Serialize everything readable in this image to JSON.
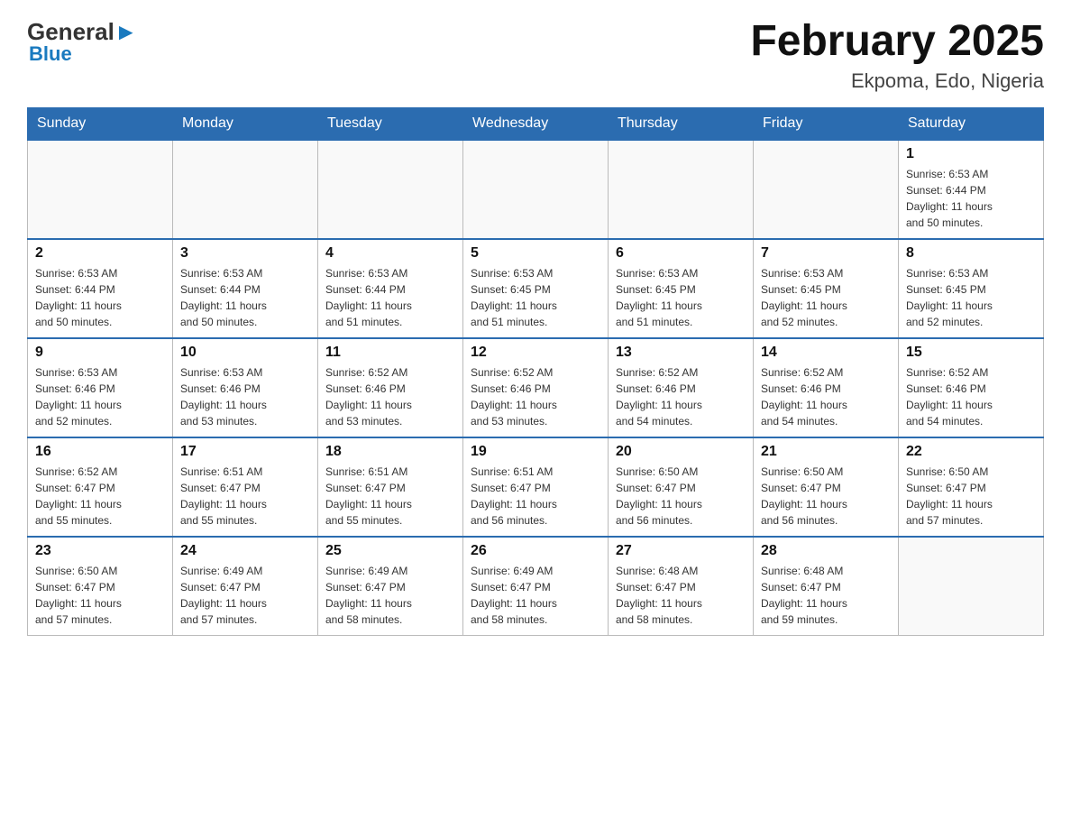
{
  "header": {
    "logo_general": "General",
    "logo_blue": "Blue",
    "month_title": "February 2025",
    "location": "Ekpoma, Edo, Nigeria"
  },
  "weekdays": [
    "Sunday",
    "Monday",
    "Tuesday",
    "Wednesday",
    "Thursday",
    "Friday",
    "Saturday"
  ],
  "weeks": [
    [
      {
        "day": "",
        "info": ""
      },
      {
        "day": "",
        "info": ""
      },
      {
        "day": "",
        "info": ""
      },
      {
        "day": "",
        "info": ""
      },
      {
        "day": "",
        "info": ""
      },
      {
        "day": "",
        "info": ""
      },
      {
        "day": "1",
        "info": "Sunrise: 6:53 AM\nSunset: 6:44 PM\nDaylight: 11 hours\nand 50 minutes."
      }
    ],
    [
      {
        "day": "2",
        "info": "Sunrise: 6:53 AM\nSunset: 6:44 PM\nDaylight: 11 hours\nand 50 minutes."
      },
      {
        "day": "3",
        "info": "Sunrise: 6:53 AM\nSunset: 6:44 PM\nDaylight: 11 hours\nand 50 minutes."
      },
      {
        "day": "4",
        "info": "Sunrise: 6:53 AM\nSunset: 6:44 PM\nDaylight: 11 hours\nand 51 minutes."
      },
      {
        "day": "5",
        "info": "Sunrise: 6:53 AM\nSunset: 6:45 PM\nDaylight: 11 hours\nand 51 minutes."
      },
      {
        "day": "6",
        "info": "Sunrise: 6:53 AM\nSunset: 6:45 PM\nDaylight: 11 hours\nand 51 minutes."
      },
      {
        "day": "7",
        "info": "Sunrise: 6:53 AM\nSunset: 6:45 PM\nDaylight: 11 hours\nand 52 minutes."
      },
      {
        "day": "8",
        "info": "Sunrise: 6:53 AM\nSunset: 6:45 PM\nDaylight: 11 hours\nand 52 minutes."
      }
    ],
    [
      {
        "day": "9",
        "info": "Sunrise: 6:53 AM\nSunset: 6:46 PM\nDaylight: 11 hours\nand 52 minutes."
      },
      {
        "day": "10",
        "info": "Sunrise: 6:53 AM\nSunset: 6:46 PM\nDaylight: 11 hours\nand 53 minutes."
      },
      {
        "day": "11",
        "info": "Sunrise: 6:52 AM\nSunset: 6:46 PM\nDaylight: 11 hours\nand 53 minutes."
      },
      {
        "day": "12",
        "info": "Sunrise: 6:52 AM\nSunset: 6:46 PM\nDaylight: 11 hours\nand 53 minutes."
      },
      {
        "day": "13",
        "info": "Sunrise: 6:52 AM\nSunset: 6:46 PM\nDaylight: 11 hours\nand 54 minutes."
      },
      {
        "day": "14",
        "info": "Sunrise: 6:52 AM\nSunset: 6:46 PM\nDaylight: 11 hours\nand 54 minutes."
      },
      {
        "day": "15",
        "info": "Sunrise: 6:52 AM\nSunset: 6:46 PM\nDaylight: 11 hours\nand 54 minutes."
      }
    ],
    [
      {
        "day": "16",
        "info": "Sunrise: 6:52 AM\nSunset: 6:47 PM\nDaylight: 11 hours\nand 55 minutes."
      },
      {
        "day": "17",
        "info": "Sunrise: 6:51 AM\nSunset: 6:47 PM\nDaylight: 11 hours\nand 55 minutes."
      },
      {
        "day": "18",
        "info": "Sunrise: 6:51 AM\nSunset: 6:47 PM\nDaylight: 11 hours\nand 55 minutes."
      },
      {
        "day": "19",
        "info": "Sunrise: 6:51 AM\nSunset: 6:47 PM\nDaylight: 11 hours\nand 56 minutes."
      },
      {
        "day": "20",
        "info": "Sunrise: 6:50 AM\nSunset: 6:47 PM\nDaylight: 11 hours\nand 56 minutes."
      },
      {
        "day": "21",
        "info": "Sunrise: 6:50 AM\nSunset: 6:47 PM\nDaylight: 11 hours\nand 56 minutes."
      },
      {
        "day": "22",
        "info": "Sunrise: 6:50 AM\nSunset: 6:47 PM\nDaylight: 11 hours\nand 57 minutes."
      }
    ],
    [
      {
        "day": "23",
        "info": "Sunrise: 6:50 AM\nSunset: 6:47 PM\nDaylight: 11 hours\nand 57 minutes."
      },
      {
        "day": "24",
        "info": "Sunrise: 6:49 AM\nSunset: 6:47 PM\nDaylight: 11 hours\nand 57 minutes."
      },
      {
        "day": "25",
        "info": "Sunrise: 6:49 AM\nSunset: 6:47 PM\nDaylight: 11 hours\nand 58 minutes."
      },
      {
        "day": "26",
        "info": "Sunrise: 6:49 AM\nSunset: 6:47 PM\nDaylight: 11 hours\nand 58 minutes."
      },
      {
        "day": "27",
        "info": "Sunrise: 6:48 AM\nSunset: 6:47 PM\nDaylight: 11 hours\nand 58 minutes."
      },
      {
        "day": "28",
        "info": "Sunrise: 6:48 AM\nSunset: 6:47 PM\nDaylight: 11 hours\nand 59 minutes."
      },
      {
        "day": "",
        "info": ""
      }
    ]
  ]
}
